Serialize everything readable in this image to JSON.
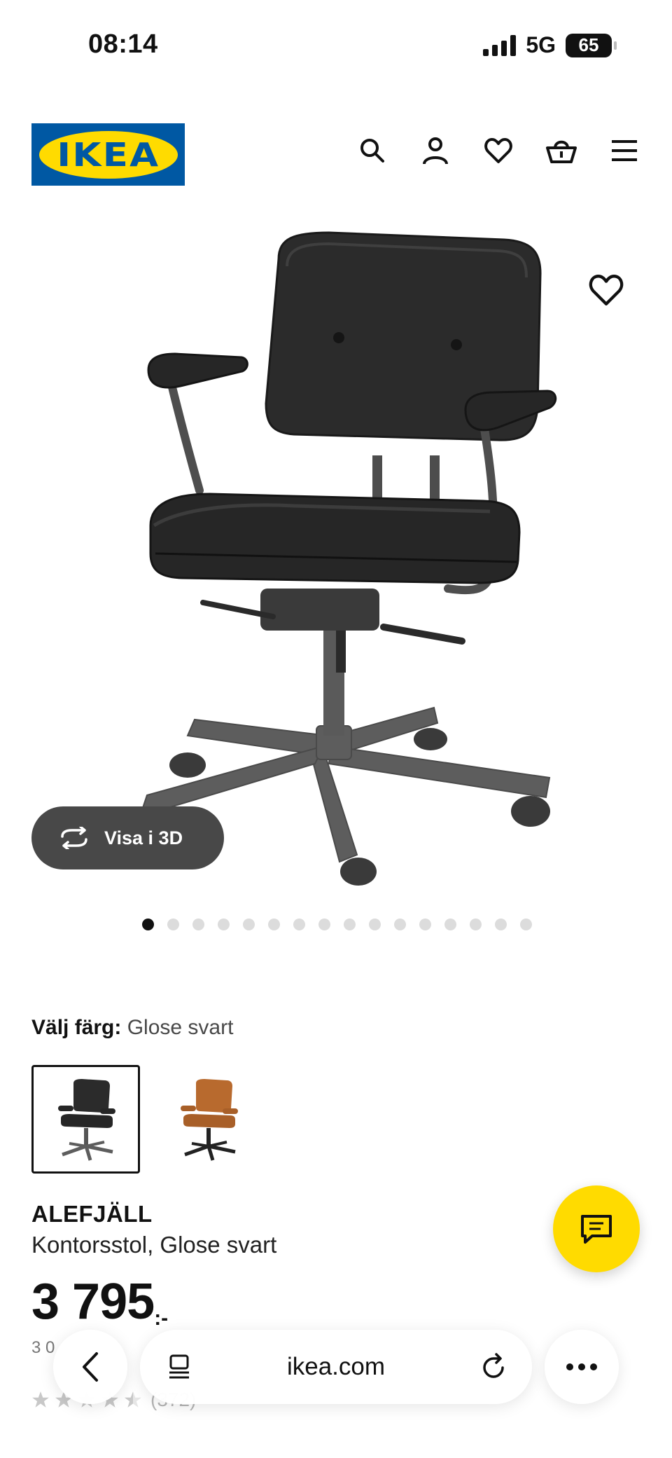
{
  "status_bar": {
    "time": "08:14",
    "network": "5G",
    "battery": "65"
  },
  "header": {
    "logo_text": "IKEA",
    "icons": [
      "search-icon",
      "user-icon",
      "heart-icon",
      "basket-icon",
      "menu-icon"
    ]
  },
  "gallery": {
    "view_3d_label": "Visa i 3D",
    "dot_count": 16,
    "active_dot": 0
  },
  "color": {
    "label": "Välj färg:",
    "selected": "Glose svart",
    "options": [
      "Glose svart",
      "Glose brun"
    ]
  },
  "product": {
    "name": "ALEFJÄLL",
    "description": "Kontorsstol, Glose svart",
    "price": "3 795",
    "price_suffix": ":-",
    "price_sub": "3 0",
    "rating_count": "(372)"
  },
  "browser": {
    "url": "ikea.com"
  },
  "colors": {
    "ikea_blue": "#0058a3",
    "ikea_yellow": "#ffdb00",
    "view3d_bg": "#484848"
  }
}
